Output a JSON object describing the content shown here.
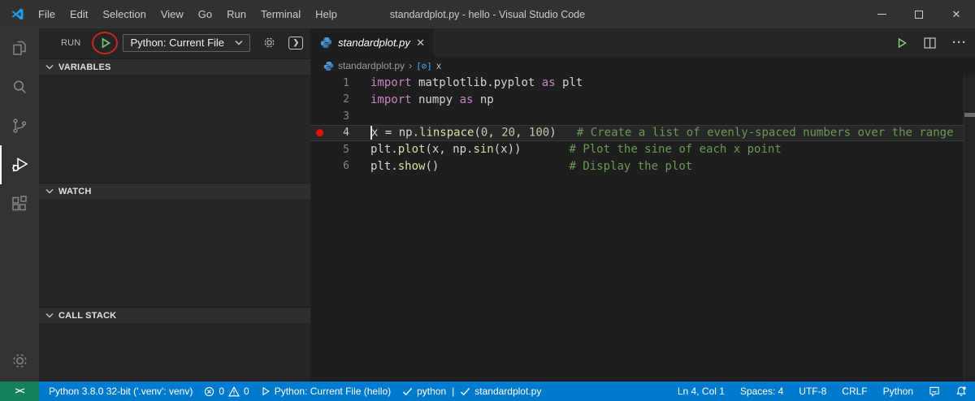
{
  "window": {
    "title": "standardplot.py - hello - Visual Studio Code",
    "menus": [
      "File",
      "Edit",
      "Selection",
      "View",
      "Go",
      "Run",
      "Terminal",
      "Help"
    ]
  },
  "activity_bar": {
    "icons": [
      "explorer-icon",
      "search-icon",
      "source-control-icon",
      "run-and-debug-icon",
      "extensions-icon",
      "settings-gear-icon"
    ],
    "active_item": "run-and-debug"
  },
  "debug_toolbar": {
    "run_label": "RUN",
    "config_label": "Python: Current File"
  },
  "sidebar_sections": [
    {
      "label": "VARIABLES"
    },
    {
      "label": "WATCH"
    },
    {
      "label": "CALL STACK"
    }
  ],
  "editor": {
    "tab_label": "standardplot.py",
    "breadcrumb_file": "standardplot.py",
    "breadcrumb_separator": "›",
    "breadcrumb_symbol_icon": "[⊘]",
    "breadcrumb_symbol": "x",
    "code_lines": [
      {
        "num": "1",
        "tokens": [
          [
            "kw",
            "import"
          ],
          [
            "pl",
            " matplotlib.pyplot "
          ],
          [
            "kw",
            "as"
          ],
          [
            "pl",
            " plt"
          ]
        ]
      },
      {
        "num": "2",
        "tokens": [
          [
            "kw",
            "import"
          ],
          [
            "pl",
            " numpy "
          ],
          [
            "kw",
            "as"
          ],
          [
            "pl",
            " np"
          ]
        ]
      },
      {
        "num": "3",
        "tokens": []
      },
      {
        "num": "4",
        "current": true,
        "breakpoint": true,
        "cursor": true,
        "tokens": [
          [
            "pl",
            "x = np."
          ],
          [
            "fn",
            "linspace"
          ],
          [
            "pl",
            "("
          ],
          [
            "num",
            "0"
          ],
          [
            "pl",
            ", "
          ],
          [
            "num",
            "20"
          ],
          [
            "pl",
            ", "
          ],
          [
            "num",
            "100"
          ],
          [
            "pl",
            ")   "
          ],
          [
            "cm",
            "# Create a list of evenly-spaced numbers over the range"
          ]
        ]
      },
      {
        "num": "5",
        "tokens": [
          [
            "pl",
            "plt."
          ],
          [
            "fn",
            "plot"
          ],
          [
            "pl",
            "(x, np."
          ],
          [
            "fn",
            "sin"
          ],
          [
            "pl",
            "(x))       "
          ],
          [
            "cm",
            "# Plot the sine of each x point"
          ]
        ]
      },
      {
        "num": "6",
        "tokens": [
          [
            "pl",
            "plt."
          ],
          [
            "fn",
            "show"
          ],
          [
            "pl",
            "()                   "
          ],
          [
            "cm",
            "# Display the plot"
          ]
        ]
      }
    ]
  },
  "status_bar": {
    "remote_glyph": "><",
    "interpreter": "Python 3.8.0 32-bit ('.venv': venv)",
    "errors": "0",
    "warnings": "0",
    "debug_config": "Python: Current File (hello)",
    "linter": "python",
    "separator": "|",
    "file_check": "standardplot.py",
    "cursor_position": "Ln 4, Col 1",
    "indentation": "Spaces: 4",
    "encoding": "UTF-8",
    "eol": "CRLF",
    "language": "Python"
  },
  "colors": {
    "accent_blue": "#007ACC",
    "remote_green": "#16825D",
    "breakpoint_red": "#E51400",
    "annotation_red": "#C8281E",
    "run_green": "#75C175",
    "keyword": "#C586C0",
    "function": "#DCDCAA",
    "number": "#B5CEA8",
    "comment": "#6A9955",
    "plain": "#D4D4D4"
  }
}
